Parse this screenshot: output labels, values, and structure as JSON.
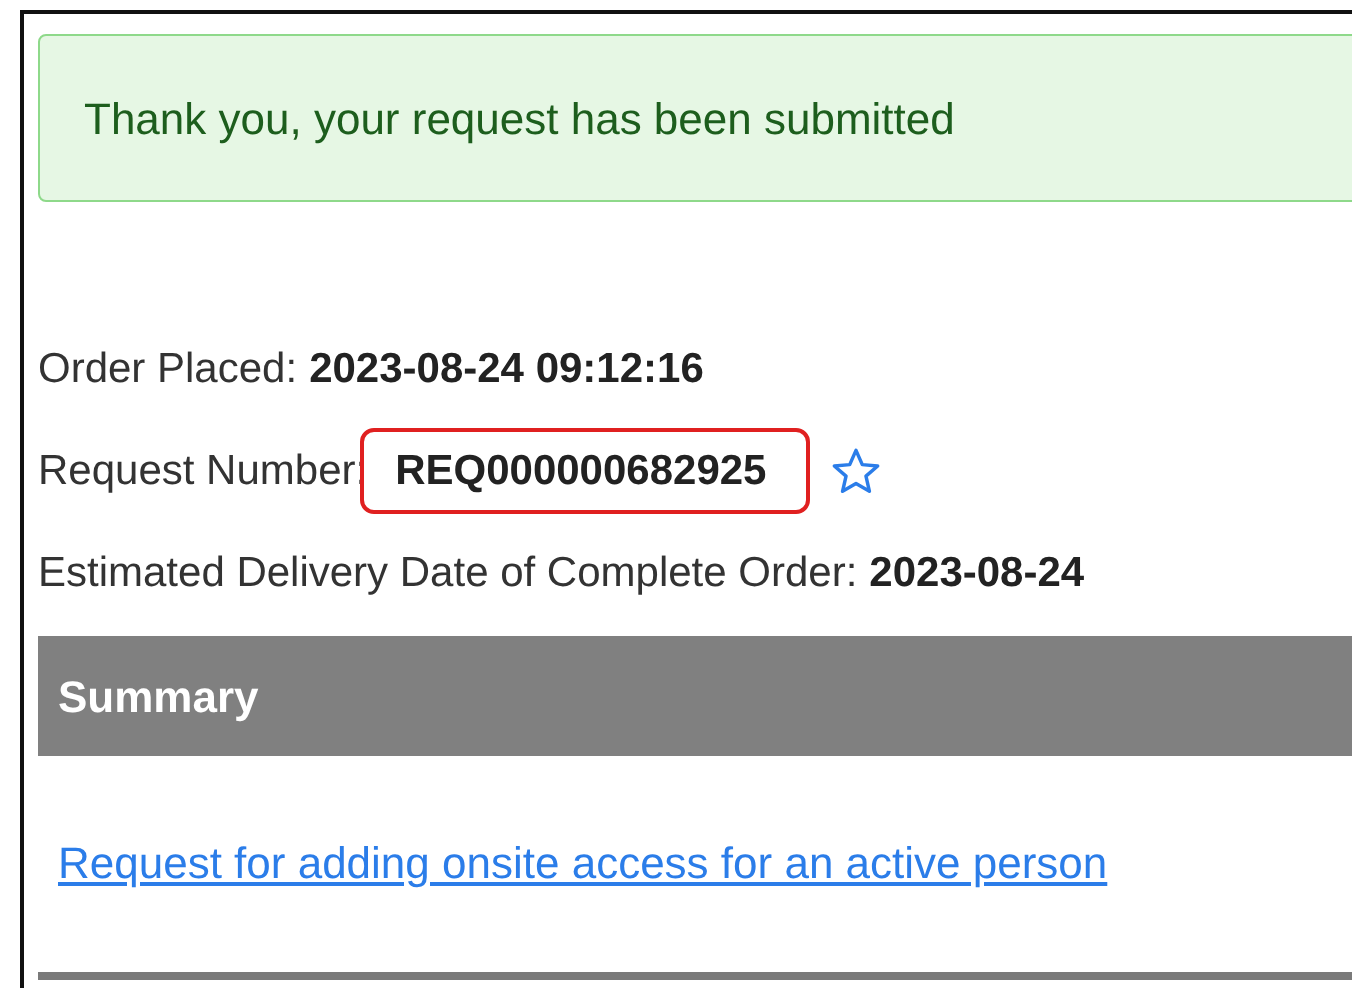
{
  "alert": {
    "message": "Thank you, your request has been submitted"
  },
  "fields": [
    {
      "label": "Order Placed:",
      "value": "2023-08-24 09:12:16",
      "highlighted": false
    },
    {
      "label": "Request Number:",
      "value": "REQ000000682925",
      "highlighted": true,
      "starred": false
    },
    {
      "label": "Estimated Delivery Date of Complete Order:",
      "value": "2023-08-24",
      "highlighted": false
    }
  ],
  "summary": {
    "heading": "Summary",
    "items": [
      {
        "link": "Request for adding onsite access for an active person"
      }
    ]
  }
}
